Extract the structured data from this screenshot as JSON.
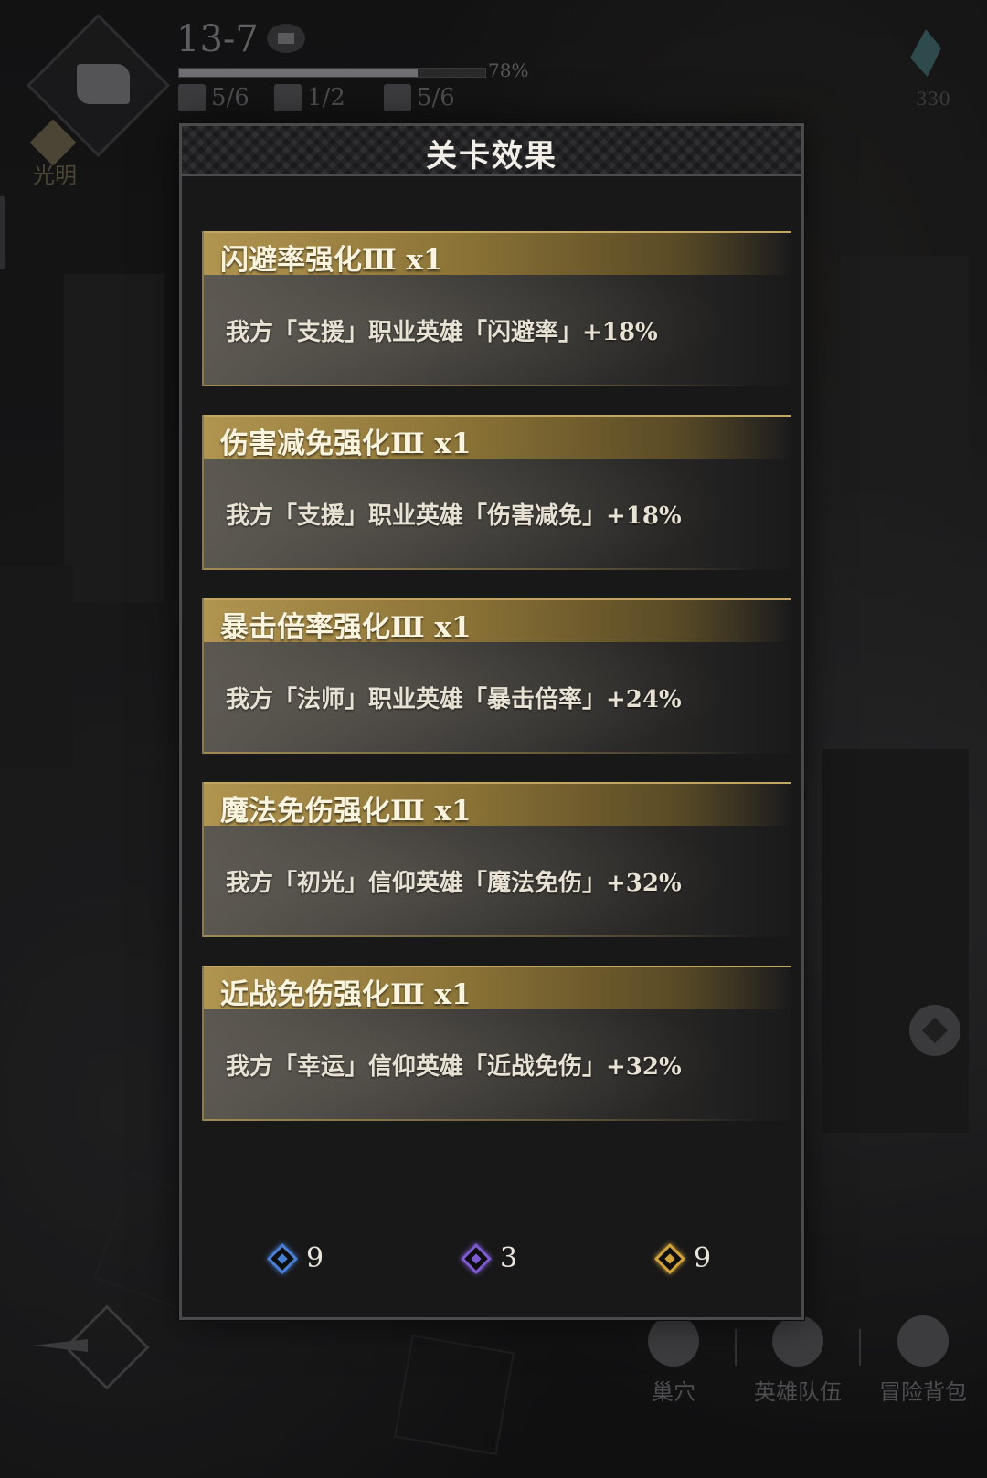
{
  "hud": {
    "stage": "13-7",
    "progress_label": "78%",
    "progress_value": 0.78,
    "stats": [
      "5/6",
      "1/2",
      "5/6"
    ],
    "faith_badge": "光明",
    "top_right_count": "330"
  },
  "bottom_menu": [
    {
      "label": "巢穴"
    },
    {
      "label": "英雄队伍"
    },
    {
      "label": "冒险背包"
    }
  ],
  "modal": {
    "title": "关卡效果",
    "effects": [
      {
        "title": "闪避率强化Ⅲ x1",
        "desc": "我方「支援」职业英雄「闪避率」+18%"
      },
      {
        "title": "伤害减免强化Ⅲ x1",
        "desc": "我方「支援」职业英雄「伤害减免」+18%"
      },
      {
        "title": "暴击倍率强化Ⅲ x1",
        "desc": "我方「法师」职业英雄「暴击倍率」+24%"
      },
      {
        "title": "魔法免伤强化Ⅲ x1",
        "desc": "我方「初光」信仰英雄「魔法免伤」+32%"
      },
      {
        "title": "近战免伤强化Ⅲ x1",
        "desc": "我方「幸运」信仰英雄「近战免伤」+32%"
      }
    ],
    "currencies": [
      {
        "name": "blue-gem",
        "value": "9",
        "color": "#4a7fd6"
      },
      {
        "name": "purple-gem",
        "value": "3",
        "color": "#7d5ad0"
      },
      {
        "name": "gold-gem",
        "value": "9",
        "color": "#d1a33a"
      }
    ]
  }
}
